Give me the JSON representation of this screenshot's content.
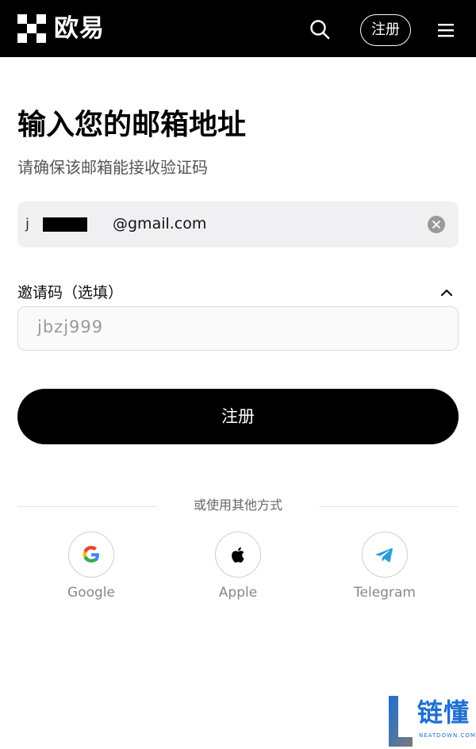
{
  "header": {
    "brand_name": "欧易",
    "logo_icon": "okx-checker-logo-icon",
    "search_icon": "search-icon",
    "signup_label": "注册",
    "menu_icon": "hamburger-menu-icon"
  },
  "form": {
    "title": "输入您的邮箱地址",
    "subtitle": "请确保该邮箱能接收验证码",
    "email": {
      "prefix": "j",
      "visible_value": "@gmail.com",
      "clear_icon": "clear-circle-icon"
    },
    "invite": {
      "label": "邀请码（选填）",
      "toggle_icon": "chevron-up-icon",
      "value": "jbzj999"
    },
    "submit_label": "注册"
  },
  "alternatives": {
    "divider_text": "或使用其他方式",
    "providers": [
      {
        "label": "Google",
        "icon": "google-icon"
      },
      {
        "label": "Apple",
        "icon": "apple-icon"
      },
      {
        "label": "Telegram",
        "icon": "telegram-icon"
      }
    ]
  },
  "watermark": {
    "text": "链懂",
    "sub_text": "NEATDOWN.COM"
  },
  "colors": {
    "header_bg": "#000000",
    "button_bg": "#000000",
    "field_bg": "#f0f0f2",
    "telegram_blue": "#2a9ed8",
    "watermark_blue": "#1e6fd0"
  }
}
